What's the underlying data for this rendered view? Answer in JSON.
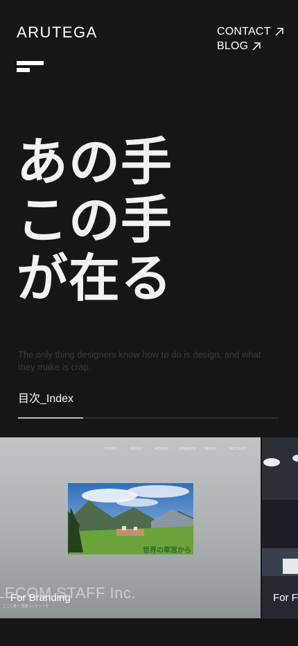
{
  "header": {
    "logo": "ARUTEGA",
    "nav": [
      {
        "label": "CONTACT"
      },
      {
        "label": "BLOG"
      }
    ]
  },
  "hero": {
    "lines": [
      "あの手",
      "この手",
      "が在る"
    ]
  },
  "tagline": "The only thing designers know how to do is design, and what they make is crap.",
  "index": {
    "label": "目次_Index",
    "progress": 0.25
  },
  "carousel": {
    "slides": [
      {
        "label": "For Branding",
        "preview": {
          "nav": [
            "HOME",
            "ABOUT",
            "WORKS",
            "AWARDS",
            "NEWS",
            "RECRUIT"
          ],
          "photo_caption": "世界の車窓から",
          "watermark": "LECOM STAFF Inc.",
          "sub": "ここに書く 情報コンテンツを"
        }
      },
      {
        "label": "For F"
      }
    ]
  },
  "colors": {
    "background": "#161616",
    "text": "#ffffff",
    "muted": "#3c3c3c"
  }
}
